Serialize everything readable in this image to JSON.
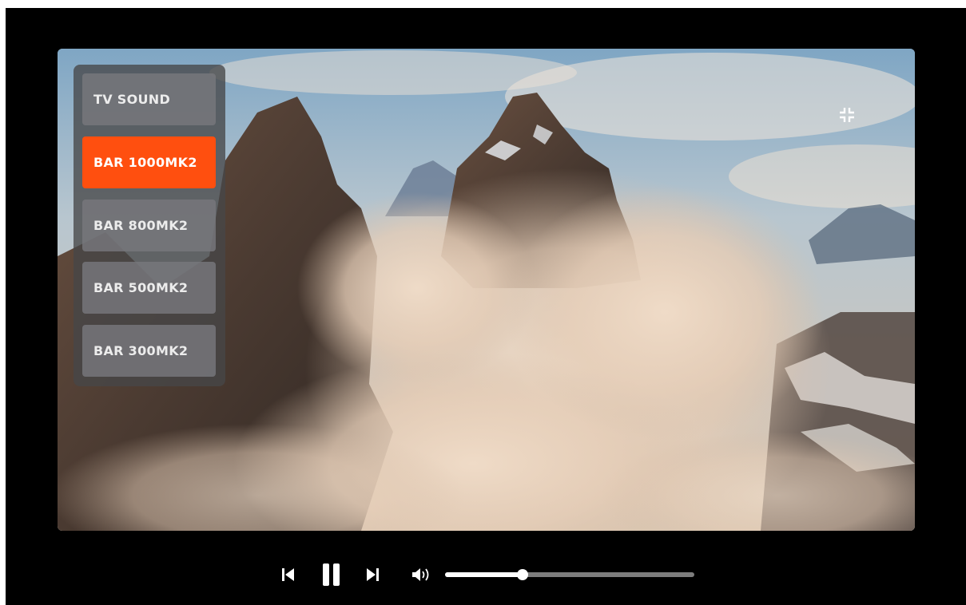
{
  "player": {
    "video": {
      "description_icon": "landscape-video-frame"
    },
    "sound_output_menu": {
      "items": [
        {
          "label": "TV SOUND",
          "selected": false
        },
        {
          "label": "BAR 1000MK2",
          "selected": true
        },
        {
          "label": "BAR 800MK2",
          "selected": false
        },
        {
          "label": "BAR 500MK2",
          "selected": false
        },
        {
          "label": "BAR 300MK2",
          "selected": false
        }
      ],
      "item_color": "#78787c",
      "selected_color": "#ff4f0f"
    },
    "exit_fullscreen": {
      "icon": "exit-fullscreen-icon"
    },
    "controls": {
      "previous_icon": "skip-previous-icon",
      "play_pause_icon": "pause-icon",
      "next_icon": "skip-next-icon",
      "volume_icon": "volume-icon",
      "volume_level": 0.31
    },
    "colors": {
      "background": "#000000",
      "accent": "#ff4f0f",
      "slider_track": "#7d7d7d",
      "slider_fill": "#ffffff"
    }
  }
}
